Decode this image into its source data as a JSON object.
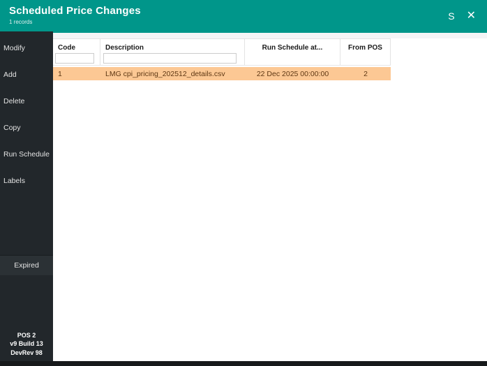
{
  "header": {
    "title": "Scheduled Price Changes",
    "record_count": "1 records",
    "s_button_label": "S",
    "close_button_glyph": "✕"
  },
  "sidebar": {
    "items": [
      {
        "label": "Modify"
      },
      {
        "label": "Add"
      },
      {
        "label": "Delete"
      },
      {
        "label": "Copy"
      },
      {
        "label": "Run Schedule"
      },
      {
        "label": "Labels"
      }
    ],
    "expired_label": "Expired",
    "footer": {
      "line1": "POS 2",
      "line2": "v9 Build 13 DevRev 98"
    }
  },
  "table": {
    "columns": [
      {
        "label": "Code",
        "has_filter": true,
        "filter_value": ""
      },
      {
        "label": "Description",
        "has_filter": true,
        "filter_value": ""
      },
      {
        "label": "Run Schedule at...",
        "has_filter": false
      },
      {
        "label": "From POS",
        "has_filter": false
      }
    ],
    "rows": [
      {
        "code": "1",
        "description": "LMG cpi_pricing_202512_details.csv",
        "run_schedule_at": "22 Dec 2025 00:00:00",
        "from_pos": "2"
      }
    ]
  },
  "colors": {
    "header_teal": "#00968A",
    "sidebar_dark": "#22272B",
    "selected_row_orange": "#FCC894",
    "selected_row_text": "#5E3713",
    "bottom_bar": "#17191B"
  }
}
